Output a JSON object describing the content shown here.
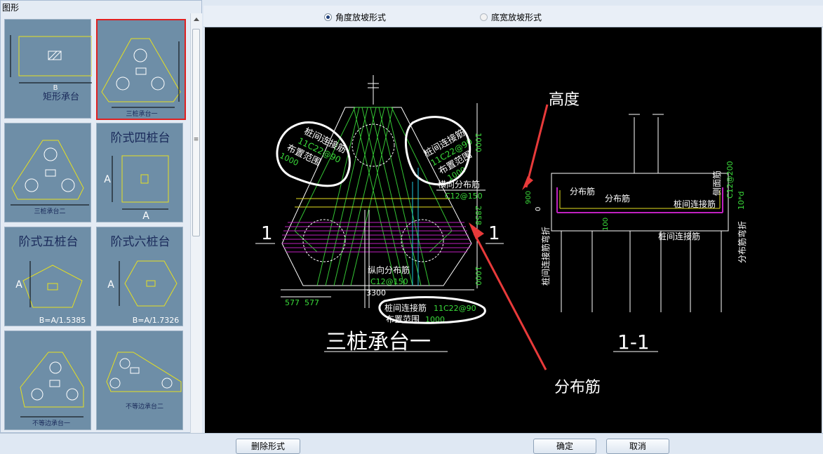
{
  "panel_title": "图形",
  "thumbnails": [
    {
      "label": "矩形承台",
      "dim_label": "B"
    },
    {
      "label": "三桩承台一",
      "selected": true
    },
    {
      "label": "三桩承台二"
    },
    {
      "label": "阶式四桩台",
      "dim_label": "A",
      "dim_label2": "A"
    },
    {
      "label": "阶式五桩台",
      "dim_label": "A",
      "formula": "B=A/1.5385"
    },
    {
      "label": "阶式六桩台",
      "dim_label": "A",
      "formula": "B=A/1.7326"
    },
    {
      "label": "不等边承台一"
    },
    {
      "label": "不等边承台二"
    }
  ],
  "options": {
    "angle": "角度放坡形式",
    "width": "底宽放坡形式"
  },
  "drawing": {
    "main_title": "三桩承台一",
    "section_title": "1-1",
    "section_mark": "1",
    "label_between_pile_1": "桩间连接筋",
    "label_between_pile_1_spec": "11C22@90",
    "label_range_1": "布置范围",
    "label_range_1_value": "1000",
    "label_between_pile_2": "桩间连接筋",
    "label_between_pile_2_spec": "11C22@90",
    "label_range_2": "布置范围",
    "label_range_2_value": "1000",
    "label_horiz_dist": "横向分布筋",
    "label_horiz_dist_spec": "C12@150",
    "label_vert_dist": "纵向分布筋",
    "label_vert_dist_spec": "C12@150",
    "label_between_pile_3": "桩间连接筋",
    "label_between_pile_3_spec": "11C22@90",
    "label_range_3": "布置范围",
    "label_range_3_value": "1000",
    "dim_1000_a": "1000",
    "dim_2858": "2858",
    "dim_1000_b": "1000",
    "dim_3300": "3300",
    "dim_577_a": "577",
    "dim_577_b": "577",
    "annot_height": "高度",
    "annot_dist": "分布筋",
    "sec_dist_1": "分布筋",
    "sec_dist_2": "分布筋",
    "sec_between_1": "桩间连接筋",
    "sec_between_2": "桩间连接筋",
    "sec_side": "侧面筋",
    "sec_side_spec": "C12@200",
    "sec_bent": "分布筋弯折",
    "sec_bent_val": "10*d",
    "sec_between_bent": "桩间连接筋弯折",
    "sec_900": "900",
    "sec_0": "0",
    "sec_100": "100"
  },
  "buttons": {
    "left": "删除形式",
    "ok": "确定",
    "cancel": "取消"
  },
  "colors": {
    "thumb_bg": "#6e8ea7",
    "yellow": "#e6e020",
    "green": "#3adb3a",
    "magenta": "#c020c0",
    "annotation_red": "#e83a3a"
  }
}
